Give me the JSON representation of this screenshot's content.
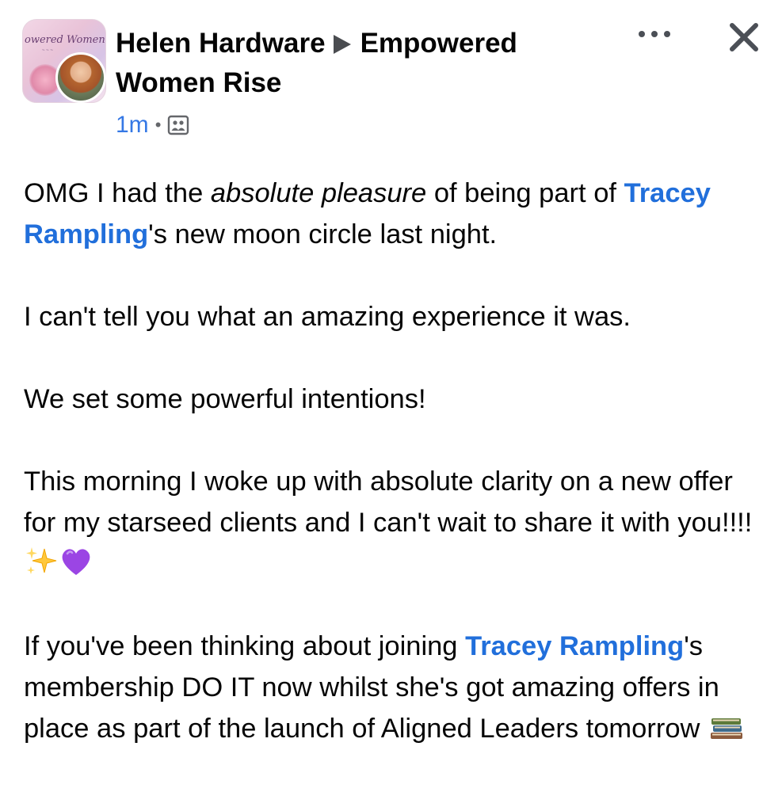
{
  "post": {
    "author": "Helen Hardware",
    "group": "Empowered Women Rise",
    "group_avatar_text": "owered Women",
    "timestamp": "1m",
    "separator": "•",
    "audience_icon": "group-audience-icon",
    "more_icon": "more-horizontal-icon",
    "close_icon": "close-x-icon",
    "paragraphs": {
      "p1": {
        "t1": "OMG I had the ",
        "em": "absolute pleasure",
        "t2": " of being part of ",
        "mention": "Tracey Rampling",
        "t3": "'s new moon circle last night."
      },
      "p2": "I can't tell you what an amazing experience it was.",
      "p3": "We set some powerful intentions!",
      "p4": {
        "text": "This morning I woke up with absolute clarity on a new offer for my starseed clients and I can't wait to share it with you!!!! ",
        "emojis": [
          "sparkles-icon",
          "purple-heart-icon"
        ]
      },
      "p5": {
        "t1": "If you've been thinking about joining ",
        "mention": "Tracey Rampling",
        "t2": "'s membership DO IT now whilst she's got amazing offers in place as part of the launch of Aligned Leaders tomorrow ",
        "emoji": "books-icon"
      }
    }
  },
  "colors": {
    "link": "#216fdb",
    "timestamp": "#3578e5",
    "text": "#050505",
    "icon": "#4b4f56"
  }
}
